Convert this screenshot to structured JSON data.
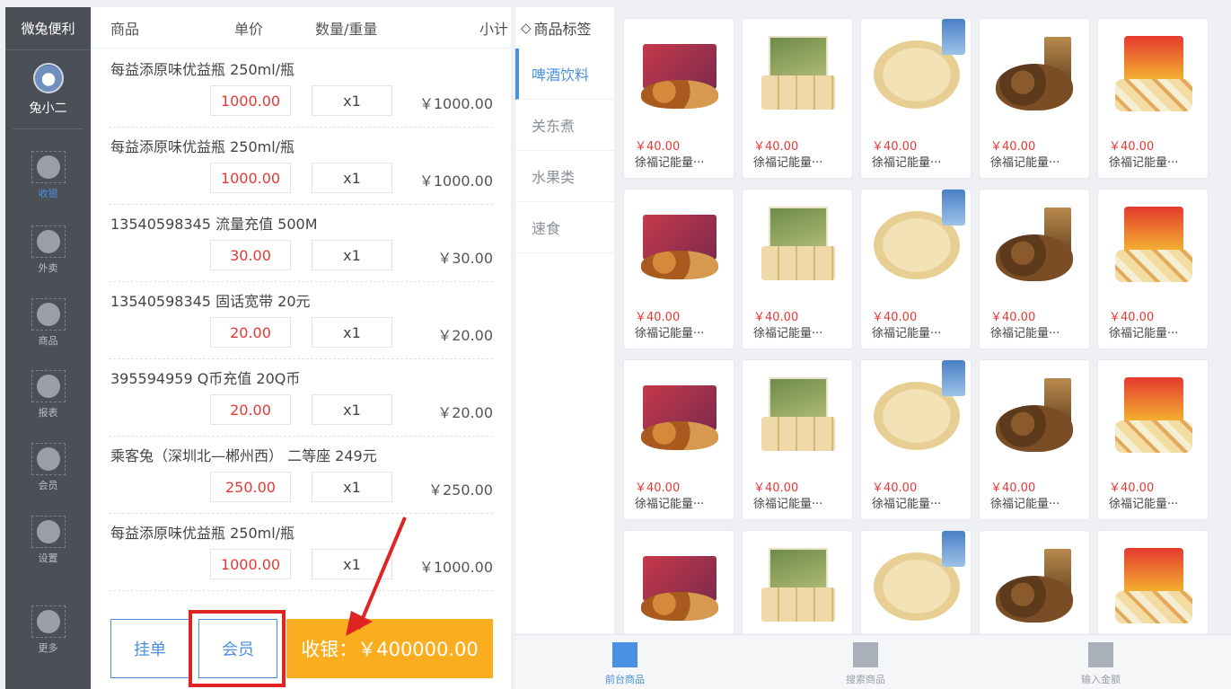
{
  "nav": {
    "brand": "微兔便利",
    "user_name": "兔小二",
    "items": [
      {
        "label": "收银",
        "active": true
      },
      {
        "label": "外卖",
        "active": false
      },
      {
        "label": "商品",
        "active": false
      },
      {
        "label": "报表",
        "active": false
      },
      {
        "label": "会员",
        "active": false
      },
      {
        "label": "设置",
        "active": false
      },
      {
        "label": "更多",
        "active": false
      }
    ]
  },
  "order": {
    "columns": {
      "name": "商品",
      "price": "单价",
      "qty": "数量/重量",
      "subtotal": "小计"
    },
    "items": [
      {
        "name": "每益添原味优益瓶  250ml/瓶",
        "price": "1000.00",
        "qty": "x1",
        "subtotal": "￥1000.00"
      },
      {
        "name": "每益添原味优益瓶  250ml/瓶",
        "price": "1000.00",
        "qty": "x1",
        "subtotal": "￥1000.00"
      },
      {
        "name": "13540598345  流量充值 500M",
        "price": "30.00",
        "qty": "x1",
        "subtotal": "￥30.00"
      },
      {
        "name": "13540598345  固话宽带 20元",
        "price": "20.00",
        "qty": "x1",
        "subtotal": "￥20.00"
      },
      {
        "name": "395594959  Q币充值 20Q币",
        "price": "20.00",
        "qty": "x1",
        "subtotal": "￥20.00"
      },
      {
        "name": "乘客兔（深圳北—郴州西）  二等座 249元",
        "price": "250.00",
        "qty": "x1",
        "subtotal": "￥250.00"
      },
      {
        "name": "每益添原味优益瓶     250ml/瓶",
        "price": "1000.00",
        "qty": "x1",
        "subtotal": "￥1000.00"
      },
      {
        "name": "每益添原味优益瓶     250ml/瓶",
        "price": "",
        "qty": "",
        "subtotal": ""
      }
    ],
    "hold_label": "挂单",
    "member_label": "会员",
    "checkout_label": "收银：￥400000.00"
  },
  "tags": {
    "header": "商品标签",
    "items": [
      {
        "label": "啤酒饮料",
        "active": true
      },
      {
        "label": "关东煮",
        "active": false
      },
      {
        "label": "水果类",
        "active": false
      },
      {
        "label": "速食",
        "active": false
      }
    ]
  },
  "products": [
    {
      "price": "￥40.00",
      "name": "徐福记能量···",
      "art": "nut-box"
    },
    {
      "price": "￥40.00",
      "name": "徐福记能量···",
      "art": "snack-bar"
    },
    {
      "price": "￥40.00",
      "name": "徐福记能量···",
      "art": "noodle"
    },
    {
      "price": "￥40.00",
      "name": "徐福记能量···",
      "art": "mushroom"
    },
    {
      "price": "￥40.00",
      "name": "徐福记能量···",
      "art": "candy"
    },
    {
      "price": "￥40.00",
      "name": "徐福记能量···",
      "art": "nut-box"
    },
    {
      "price": "￥40.00",
      "name": "徐福记能量···",
      "art": "snack-bar"
    },
    {
      "price": "￥40.00",
      "name": "徐福记能量···",
      "art": "noodle"
    },
    {
      "price": "￥40.00",
      "name": "徐福记能量···",
      "art": "mushroom"
    },
    {
      "price": "￥40.00",
      "name": "徐福记能量···",
      "art": "candy"
    },
    {
      "price": "￥40.00",
      "name": "徐福记能量···",
      "art": "nut-box"
    },
    {
      "price": "￥40.00",
      "name": "徐福记能量···",
      "art": "snack-bar"
    },
    {
      "price": "￥40.00",
      "name": "徐福记能量···",
      "art": "noodle"
    },
    {
      "price": "￥40.00",
      "name": "徐福记能量···",
      "art": "mushroom"
    },
    {
      "price": "￥40.00",
      "name": "徐福记能量···",
      "art": "candy"
    },
    {
      "price": "",
      "name": "",
      "art": "nut-box"
    },
    {
      "price": "",
      "name": "",
      "art": "snack-bar"
    },
    {
      "price": "",
      "name": "",
      "art": "noodle"
    },
    {
      "price": "",
      "name": "",
      "art": "mushroom"
    },
    {
      "price": "",
      "name": "",
      "art": "candy"
    }
  ],
  "toolbar": {
    "items": [
      {
        "label": "前台商品",
        "active": true
      },
      {
        "label": "搜索商品",
        "active": false
      },
      {
        "label": "输入金额",
        "active": false
      }
    ]
  },
  "colors": {
    "accent": "#4a90e2",
    "price_red": "#e53935",
    "checkout_orange": "#f9ad1f",
    "highlight_red": "#e02424",
    "nav_bg": "#4b4f56"
  }
}
